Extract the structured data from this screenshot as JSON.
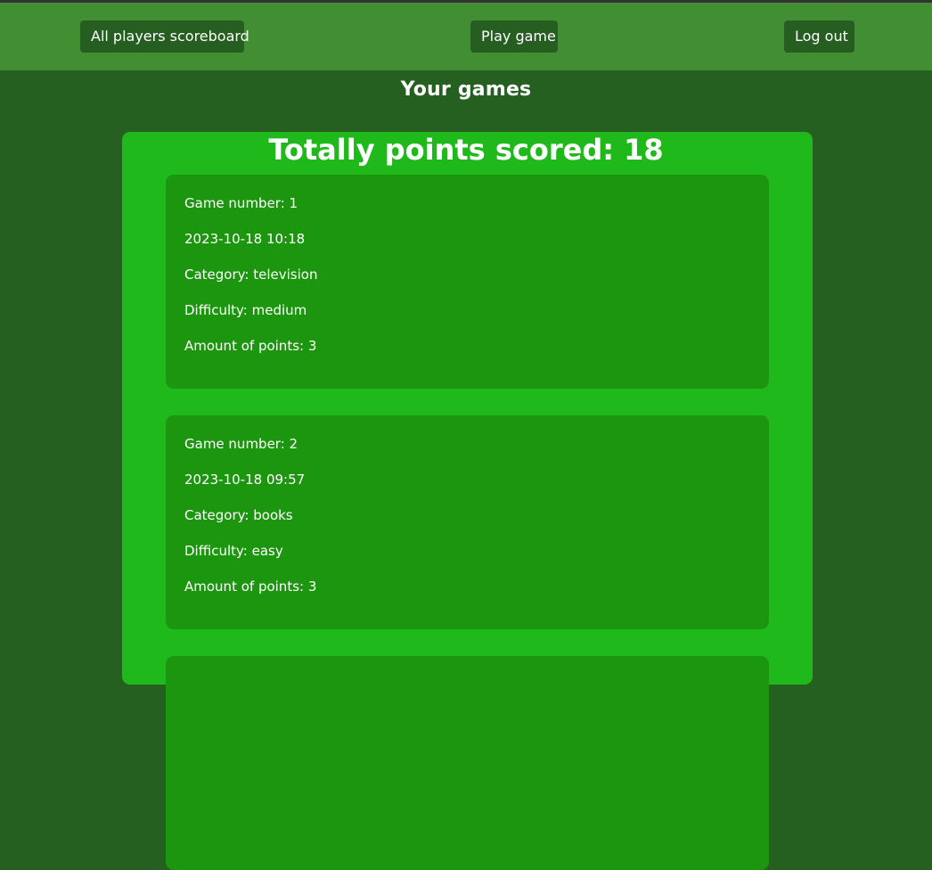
{
  "nav": {
    "scoreboard_label": "All players scoreboard",
    "play_label": "Play game",
    "logout_label": "Log out"
  },
  "page": {
    "title": "Your games",
    "total_points_text": "Totally points scored: 18"
  },
  "games": [
    {
      "number_text": "Game number: 1",
      "datetime": "2023-10-18 10:18",
      "category_text": "Category: television",
      "difficulty_text": "Difficulty: medium",
      "points_text": "Amount of points: 3"
    },
    {
      "number_text": "Game number: 2",
      "datetime": "2023-10-18 09:57",
      "category_text": "Category: books",
      "difficulty_text": "Difficulty: easy",
      "points_text": "Amount of points: 3"
    }
  ],
  "colors": {
    "background": "#256020",
    "navbar": "#428f33",
    "nav_button": "#265d20",
    "panel": "#20b91b",
    "card": "#1c960e"
  }
}
